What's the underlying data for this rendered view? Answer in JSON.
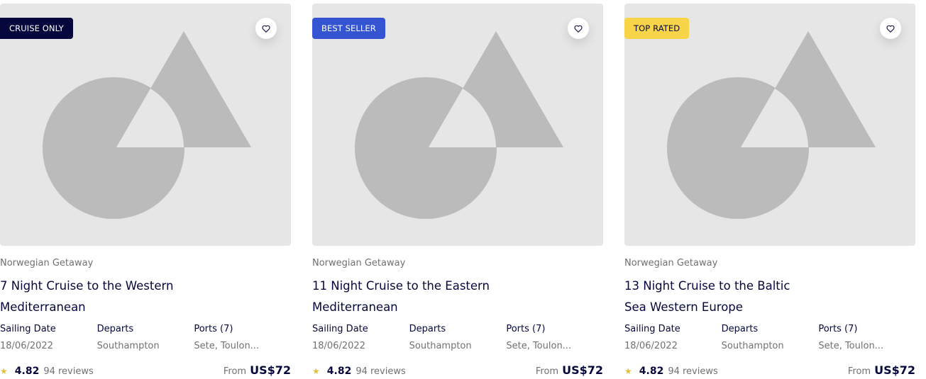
{
  "colors": {
    "navy": "#05073c",
    "blue": "#3554d1",
    "yellow": "#f8d448",
    "muted": "#717171",
    "placeholder_bg": "#e6e6e6",
    "placeholder_shape": "#bbbbbb",
    "star": "#e1c03f"
  },
  "cards": [
    {
      "badge": {
        "label": "CRUISE ONLY",
        "bg": "#05073c",
        "fg": "#ffffff"
      },
      "ship": "Norwegian Getaway",
      "title": "7 Night Cruise to the Western Mediterranean",
      "specs": [
        {
          "label": "Sailing Date",
          "value": "18/06/2022"
        },
        {
          "label": "Departs",
          "value": "Southampton"
        },
        {
          "label": "Ports (7)",
          "value": "Sete, Toulon..."
        }
      ],
      "rating": "4.82",
      "reviews": "94 reviews",
      "price_prefix": "From",
      "price": "US$72",
      "favorite_icon": "heart-outline-icon"
    },
    {
      "badge": {
        "label": "BEST SELLER",
        "bg": "#3554d1",
        "fg": "#ffffff"
      },
      "ship": "Norwegian Getaway",
      "title": "11 Night Cruise to the Eastern Mediterranean",
      "specs": [
        {
          "label": "Sailing Date",
          "value": "18/06/2022"
        },
        {
          "label": "Departs",
          "value": "Southampton"
        },
        {
          "label": "Ports (7)",
          "value": "Sete, Toulon..."
        }
      ],
      "rating": "4.82",
      "reviews": "94 reviews",
      "price_prefix": "From",
      "price": "US$72",
      "favorite_icon": "heart-outline-icon"
    },
    {
      "badge": {
        "label": "TOP RATED",
        "bg": "#f8d448",
        "fg": "#05073c"
      },
      "ship": "Norwegian Getaway",
      "title": "13 Night Cruise to the Baltic Sea Western Europe",
      "specs": [
        {
          "label": "Sailing Date",
          "value": "18/06/2022"
        },
        {
          "label": "Departs",
          "value": "Southampton"
        },
        {
          "label": "Ports (7)",
          "value": "Sete, Toulon..."
        }
      ],
      "rating": "4.82",
      "reviews": "94 reviews",
      "price_prefix": "From",
      "price": "US$72",
      "favorite_icon": "heart-outline-icon"
    }
  ]
}
